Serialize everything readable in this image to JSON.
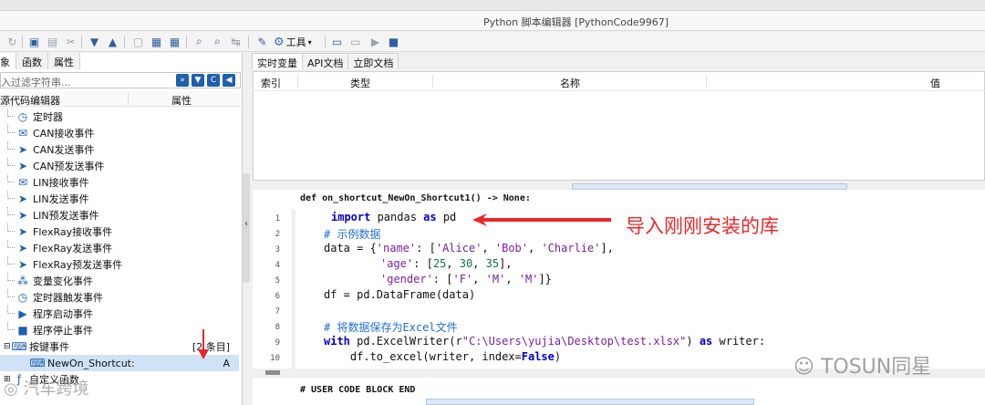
{
  "window": {
    "title": "Python 脚本编辑器 [PythonCode9967]"
  },
  "toolbar": {
    "tools_label": "工具"
  },
  "left": {
    "tabs": [
      "象",
      "函数",
      "属性"
    ],
    "filter_placeholder": "入过滤字符串...",
    "columns": {
      "name": "源代码编辑器",
      "prop": "属性"
    },
    "items": [
      {
        "label": "定时器",
        "icon": "clock-icon"
      },
      {
        "label": "CAN接收事件",
        "icon": "envelope-icon"
      },
      {
        "label": "CAN发送事件",
        "icon": "send-icon"
      },
      {
        "label": "CAN预发送事件",
        "icon": "send-icon"
      },
      {
        "label": "LIN接收事件",
        "icon": "envelope-icon"
      },
      {
        "label": "LIN发送事件",
        "icon": "send-icon"
      },
      {
        "label": "LIN预发送事件",
        "icon": "send-icon"
      },
      {
        "label": "FlexRay接收事件",
        "icon": "send-icon"
      },
      {
        "label": "FlexRay发送事件",
        "icon": "send-icon"
      },
      {
        "label": "FlexRay预发送事件",
        "icon": "send-icon"
      },
      {
        "label": "变量变化事件",
        "icon": "network-icon"
      },
      {
        "label": "定时器触发事件",
        "icon": "clock-icon"
      },
      {
        "label": "程序启动事件",
        "icon": "play-icon"
      },
      {
        "label": "程序停止事件",
        "icon": "stop-icon"
      },
      {
        "label": "按键事件",
        "icon": "keyboard-icon",
        "value": "[2 条目]"
      },
      {
        "label": "NewOn_Shortcut:",
        "icon": "keyboard-icon",
        "value": "A"
      },
      {
        "label": "自定义函数",
        "icon": "function-icon"
      }
    ]
  },
  "right": {
    "tabs": [
      "实时变量",
      "API文档",
      "立即文档"
    ],
    "var_columns": [
      "索引",
      "类型",
      "名称",
      "值"
    ],
    "signature": "def on_shortcut_NewOn_Shortcut1() -> None:",
    "end_block": "# USER CODE BLOCK END",
    "line_numbers": [
      "1",
      "2",
      "3",
      "4",
      "5",
      "6",
      "7",
      "8",
      "9",
      "10"
    ],
    "code": {
      "l1": {
        "kw": "import",
        "rest1": " pandas ",
        "kw2": "as",
        "rest2": " pd"
      },
      "l2": "# 示例数据",
      "l3": {
        "a": "data = {",
        "s1": "'name'",
        "b": ": [",
        "s2": "'Alice'",
        "c": ", ",
        "s3": "'Bob'",
        "d": ", ",
        "s4": "'Charlie'",
        "e": "],"
      },
      "l4": {
        "s1": "'age'",
        "a": ": [",
        "n1": "25",
        "b": ", ",
        "n2": "30",
        "c": ", ",
        "n3": "35",
        "d": "],"
      },
      "l5": {
        "s1": "'gender'",
        "a": ": [",
        "s2": "'F'",
        "b": ", ",
        "s3": "'M'",
        "c": ", ",
        "s4": "'M'",
        "d": "]}"
      },
      "l6": "df = pd.DataFrame(data)",
      "l7": "",
      "l8": "# 将数据保存为Excel文件",
      "l9": {
        "kw": "with",
        "a": " pd.ExcelWriter(r",
        "s": "\"C:\\Users\\yujia\\Desktop\\test.xlsx\"",
        "b": ") ",
        "kw2": "as",
        "c": " writer:"
      },
      "l10": {
        "a": "    df.to_excel(writer, index=",
        "kw": "False",
        "b": ")"
      }
    }
  },
  "annotation": {
    "text": "导入刚刚安装的库",
    "color": "#e8282b"
  },
  "watermarks": {
    "right": "TOSUN同星",
    "left": "汽车跨境"
  }
}
